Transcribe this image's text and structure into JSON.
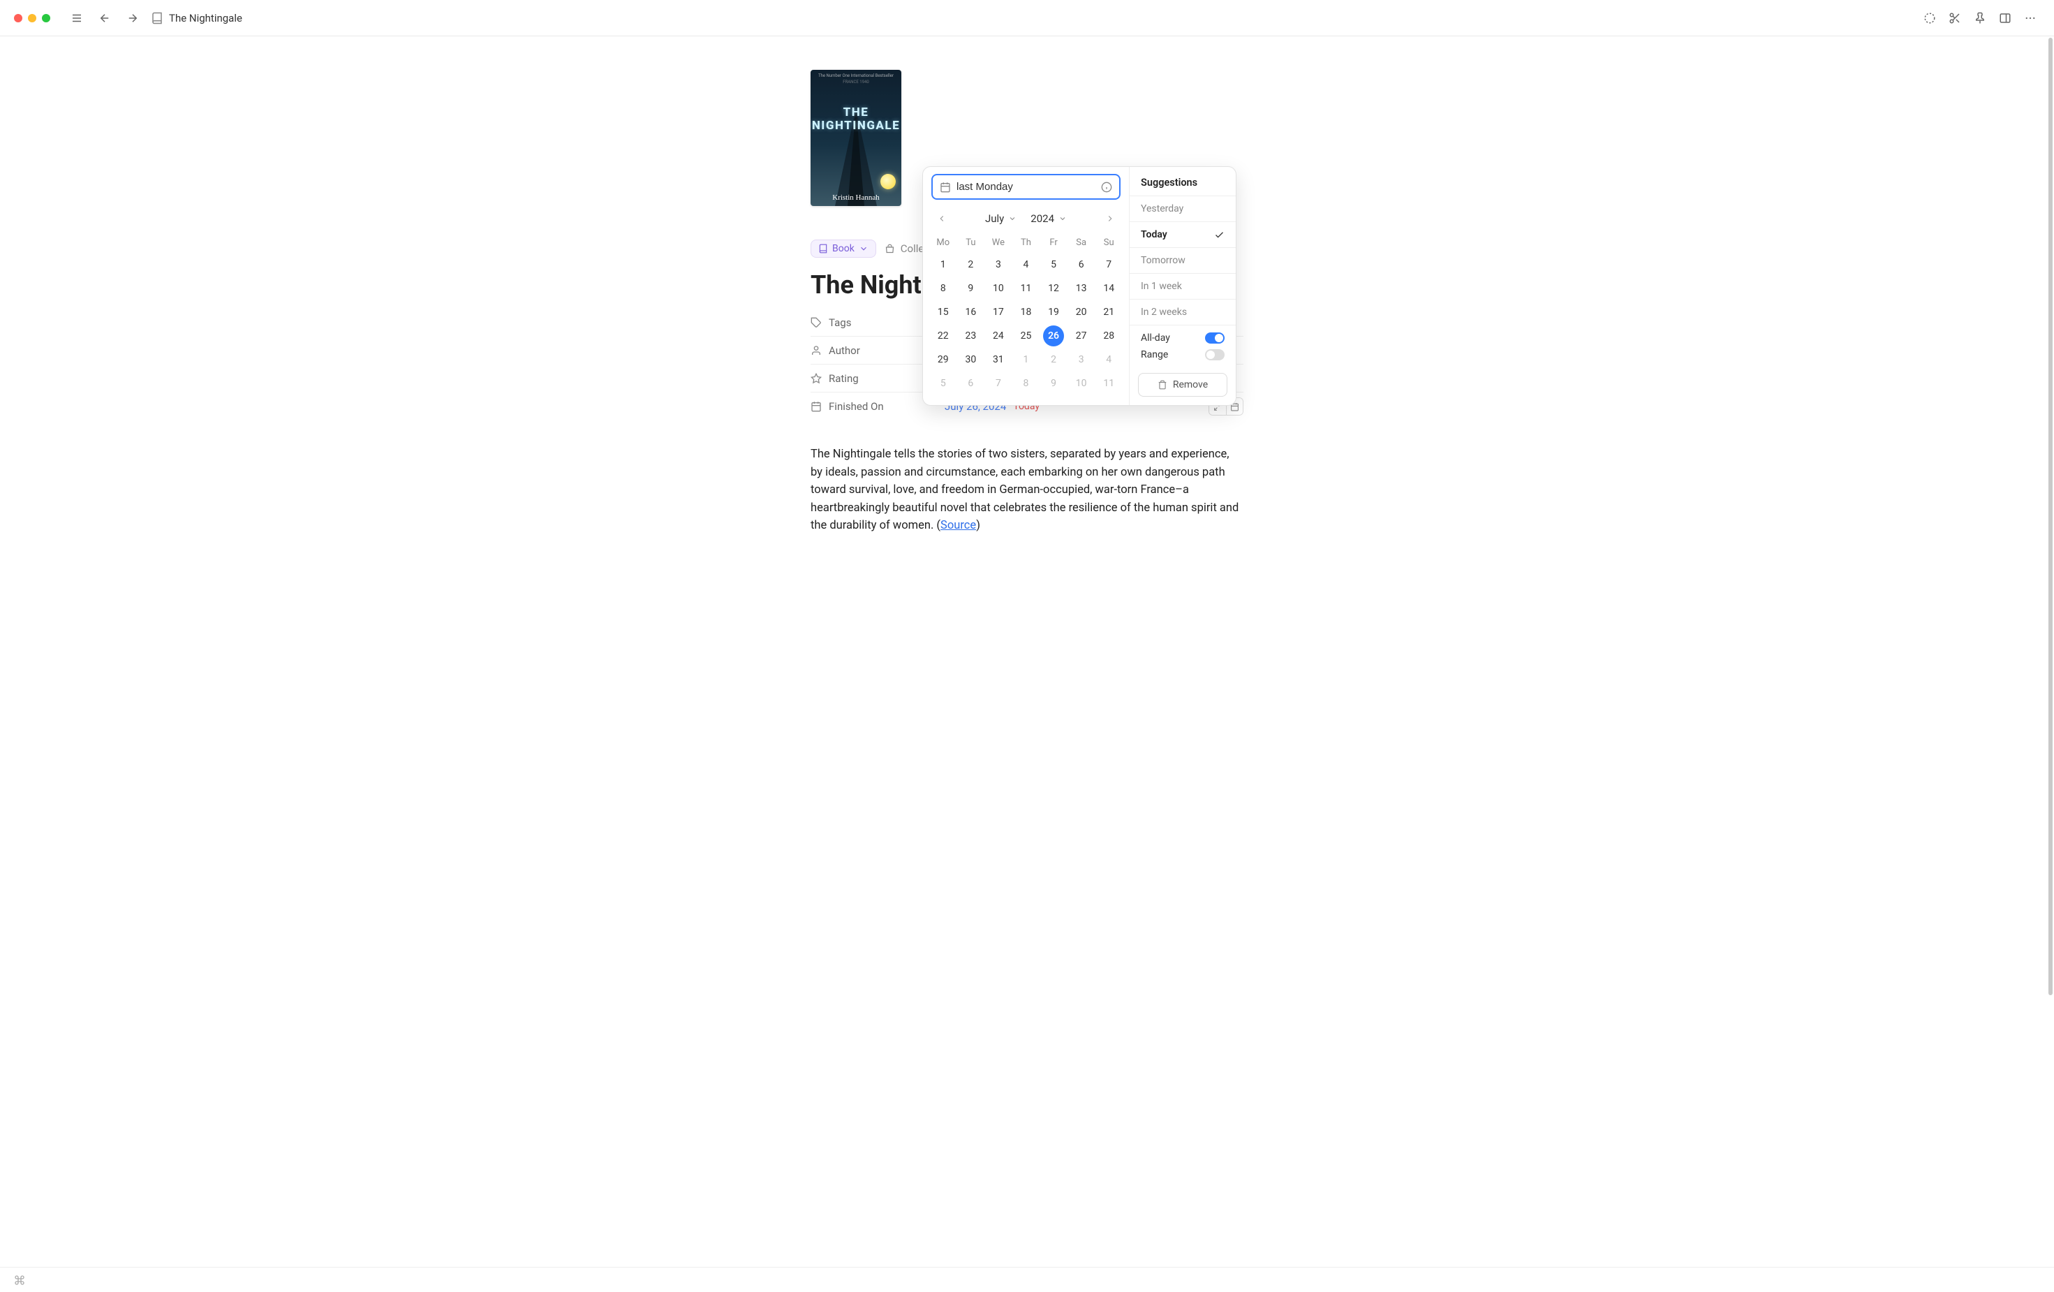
{
  "titlebar": {
    "crumb": "The Nightingale"
  },
  "chips": {
    "book_label": "Book",
    "collections_label": "Collections"
  },
  "page_title": "The Nightingale",
  "cover": {
    "top_line": "The Number One\nInternational Bestseller",
    "badge": "FRANCE 1940",
    "title_line1": "THE",
    "title_line2": "NIGHTINGALE",
    "author": "Kristin Hannah"
  },
  "props": {
    "tags_label": "Tags",
    "author_label": "Author",
    "rating_label": "Rating",
    "finished_label": "Finished On",
    "finished_value": "July 26, 2024",
    "finished_today": "Today"
  },
  "body": {
    "text": "The Nightingale tells the stories of two sisters, separated by years and experience, by ideals, passion and circumstance, each embarking on her own dangerous path toward survival, love, and freedom in German-occupied, war-torn France–a heartbreakingly beautiful novel that celebrates the resilience of the human spirit and the durability of women. (",
    "source_label": "Source",
    "close_paren": ")"
  },
  "datepicker": {
    "input_value": "last Monday",
    "month": "July",
    "year": "2024",
    "dow": [
      "Mo",
      "Tu",
      "We",
      "Th",
      "Fr",
      "Sa",
      "Su"
    ],
    "weeks": [
      [
        {
          "n": 1
        },
        {
          "n": 2
        },
        {
          "n": 3
        },
        {
          "n": 4
        },
        {
          "n": 5
        },
        {
          "n": 6
        },
        {
          "n": 7
        }
      ],
      [
        {
          "n": 8
        },
        {
          "n": 9
        },
        {
          "n": 10
        },
        {
          "n": 11
        },
        {
          "n": 12
        },
        {
          "n": 13
        },
        {
          "n": 14
        }
      ],
      [
        {
          "n": 15
        },
        {
          "n": 16
        },
        {
          "n": 17
        },
        {
          "n": 18
        },
        {
          "n": 19
        },
        {
          "n": 20
        },
        {
          "n": 21
        }
      ],
      [
        {
          "n": 22
        },
        {
          "n": 23
        },
        {
          "n": 24
        },
        {
          "n": 25
        },
        {
          "n": 26,
          "selected": true
        },
        {
          "n": 27
        },
        {
          "n": 28
        }
      ],
      [
        {
          "n": 29
        },
        {
          "n": 30
        },
        {
          "n": 31
        },
        {
          "n": 1,
          "other": true
        },
        {
          "n": 2,
          "other": true
        },
        {
          "n": 3,
          "other": true
        },
        {
          "n": 4,
          "other": true
        }
      ],
      [
        {
          "n": 5,
          "other": true
        },
        {
          "n": 6,
          "other": true
        },
        {
          "n": 7,
          "other": true
        },
        {
          "n": 8,
          "other": true
        },
        {
          "n": 9,
          "other": true
        },
        {
          "n": 10,
          "other": true
        },
        {
          "n": 11,
          "other": true
        }
      ]
    ],
    "suggestions_label": "Suggestions",
    "suggestions": [
      {
        "label": "Yesterday"
      },
      {
        "label": "Today",
        "active": true,
        "check": true
      },
      {
        "label": "Tomorrow"
      },
      {
        "label": "In 1 week"
      },
      {
        "label": "In 2 weeks"
      }
    ],
    "allday_label": "All-day",
    "range_label": "Range",
    "remove_label": "Remove"
  }
}
